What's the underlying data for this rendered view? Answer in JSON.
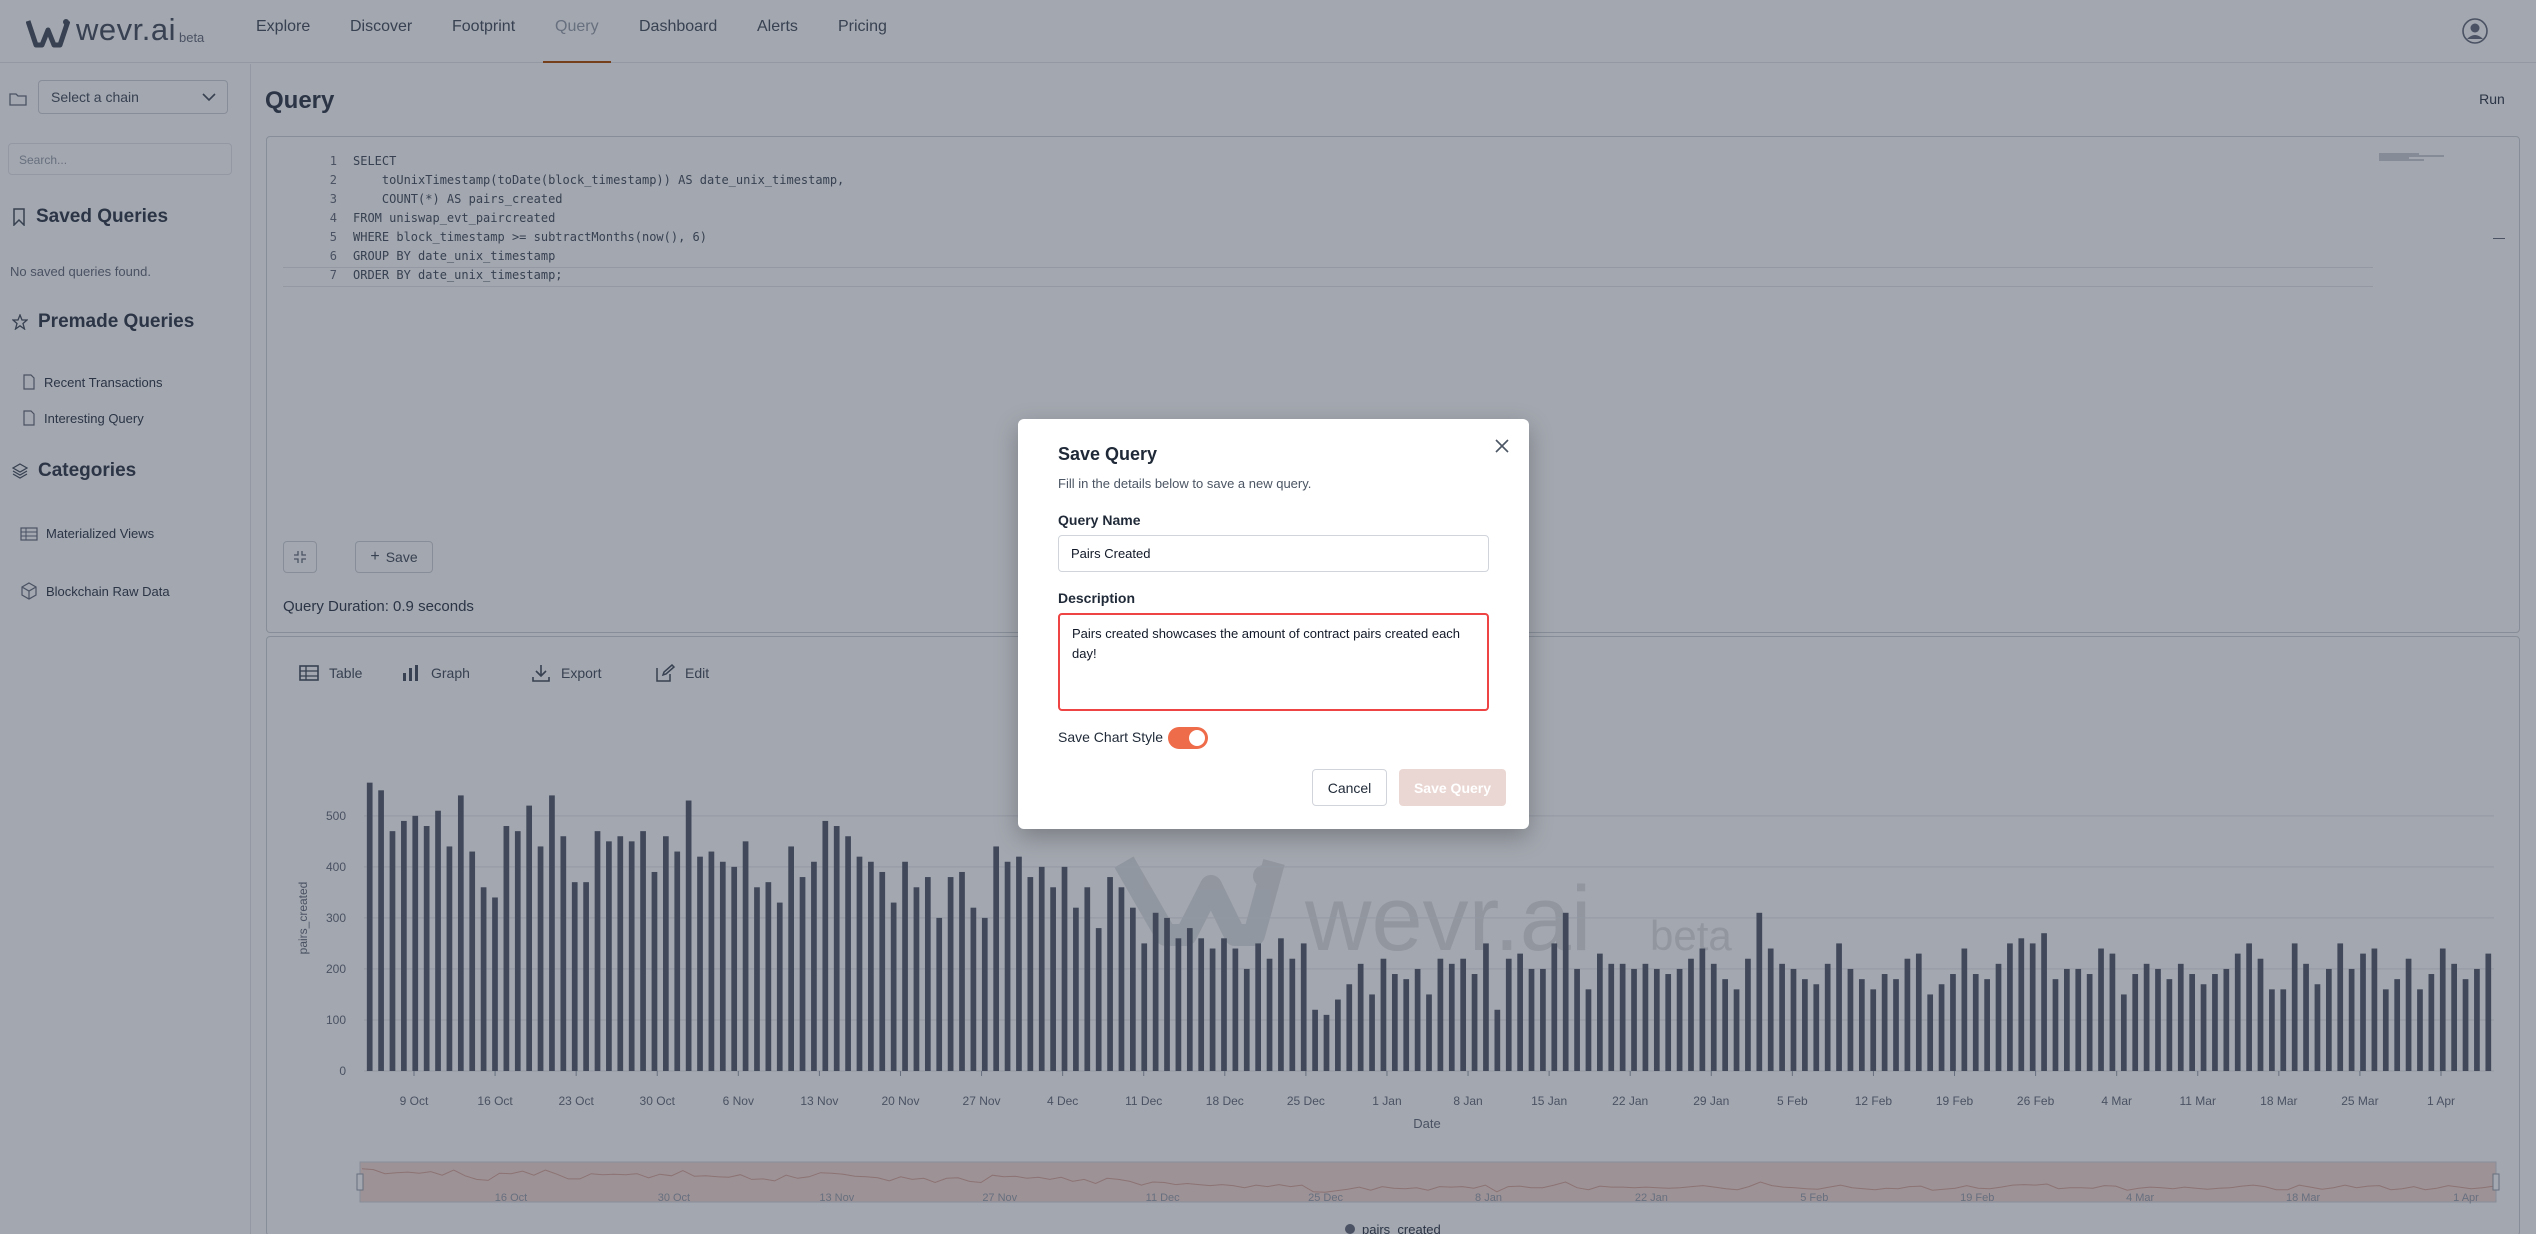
{
  "app": {
    "logo_text": "wevr.ai",
    "logo_beta": "beta"
  },
  "nav": {
    "items": [
      "Explore",
      "Discover",
      "Footprint",
      "Query",
      "Dashboard",
      "Alerts",
      "Pricing"
    ],
    "active": "Query"
  },
  "sidebar": {
    "chain_placeholder": "Select a chain",
    "search_placeholder": "Search...",
    "saved_title": "Saved Queries",
    "saved_empty": "No saved queries found.",
    "premade_title": "Premade Queries",
    "premade_items": [
      "Recent Transactions",
      "Interesting Query"
    ],
    "categories_title": "Categories",
    "category_items": [
      "Materialized Views",
      "Blockchain Raw Data"
    ]
  },
  "page": {
    "title": "Query",
    "run_label": "Run"
  },
  "editor": {
    "lines": [
      {
        "n": "1",
        "text": "SELECT"
      },
      {
        "n": "2",
        "text": "    toUnixTimestamp(toDate(block_timestamp)) AS date_unix_timestamp,"
      },
      {
        "n": "3",
        "text": "    COUNT(*) AS pairs_created"
      },
      {
        "n": "4",
        "text": "FROM uniswap_evt_paircreated"
      },
      {
        "n": "5",
        "text": "WHERE block_timestamp >= subtractMonths(now(), 6)"
      },
      {
        "n": "6",
        "text": "GROUP BY date_unix_timestamp"
      },
      {
        "n": "7",
        "text": "ORDER BY date_unix_timestamp;"
      }
    ],
    "save_label": "Save",
    "duration": "Query Duration: 0.9 seconds"
  },
  "results": {
    "tabs": [
      {
        "label": "Table",
        "icon": "table-icon"
      },
      {
        "label": "Graph",
        "icon": "bar-chart-icon"
      },
      {
        "label": "Export",
        "icon": "download-icon"
      },
      {
        "label": "Edit",
        "icon": "edit-icon"
      }
    ]
  },
  "chart_data": {
    "type": "bar",
    "xlabel": "Date",
    "ylabel": "pairs_created",
    "ylim": [
      0,
      580
    ],
    "yticks": [
      0,
      100,
      200,
      300,
      400,
      500
    ],
    "xticks": [
      "9 Oct",
      "16 Oct",
      "23 Oct",
      "30 Oct",
      "6 Nov",
      "13 Nov",
      "20 Nov",
      "27 Nov",
      "4 Dec",
      "11 Dec",
      "18 Dec",
      "25 Dec",
      "1 Jan",
      "8 Jan",
      "15 Jan",
      "22 Jan",
      "29 Jan",
      "5 Feb",
      "12 Feb",
      "19 Feb",
      "26 Feb",
      "4 Mar",
      "11 Mar",
      "18 Mar",
      "25 Mar",
      "1 Apr"
    ],
    "navigator_ticks": [
      "16 Oct",
      "30 Oct",
      "13 Nov",
      "27 Nov",
      "11 Dec",
      "25 Dec",
      "8 Jan",
      "22 Jan",
      "5 Feb",
      "19 Feb",
      "4 Mar",
      "18 Mar",
      "1 Apr"
    ],
    "legend": "pairs_created",
    "series": [
      {
        "name": "pairs_created",
        "values": [
          565,
          550,
          470,
          490,
          500,
          480,
          510,
          440,
          540,
          430,
          360,
          340,
          480,
          470,
          520,
          440,
          540,
          460,
          370,
          370,
          470,
          450,
          460,
          450,
          470,
          390,
          460,
          430,
          530,
          420,
          430,
          410,
          400,
          450,
          360,
          370,
          330,
          440,
          380,
          410,
          490,
          480,
          460,
          420,
          410,
          390,
          330,
          410,
          360,
          380,
          300,
          380,
          390,
          320,
          300,
          440,
          410,
          420,
          380,
          400,
          360,
          400,
          320,
          360,
          280,
          380,
          360,
          320,
          250,
          310,
          300,
          260,
          280,
          260,
          240,
          260,
          240,
          200,
          250,
          220,
          260,
          220,
          250,
          120,
          110,
          140,
          170,
          210,
          150,
          220,
          190,
          180,
          200,
          150,
          220,
          210,
          220,
          190,
          250,
          120,
          220,
          230,
          200,
          200,
          250,
          310,
          200,
          160,
          230,
          210,
          210,
          200,
          210,
          200,
          190,
          200,
          220,
          240,
          210,
          180,
          160,
          220,
          310,
          240,
          210,
          200,
          180,
          170,
          210,
          250,
          200,
          180,
          160,
          190,
          180,
          220,
          230,
          150,
          170,
          190,
          240,
          190,
          180,
          210,
          250,
          260,
          250,
          270,
          180,
          200,
          200,
          190,
          240,
          230,
          150,
          190,
          210,
          200,
          180,
          210,
          190,
          170,
          190,
          200,
          230,
          250,
          220,
          160,
          160,
          250,
          210,
          170,
          200,
          250,
          200,
          230,
          240,
          160,
          180,
          220,
          160,
          190,
          240,
          210,
          180,
          200,
          230
        ]
      }
    ]
  },
  "modal": {
    "title": "Save Query",
    "subtitle": "Fill in the details below to save a new query.",
    "name_label": "Query Name",
    "name_value": "Pairs Created",
    "desc_label": "Description",
    "desc_value": "Pairs created showcases the amount of contract pairs created each day!",
    "toggle_label": "Save Chart Style",
    "toggle_on": true,
    "cancel_label": "Cancel",
    "save_label": "Save Query",
    "accent": "#ef6c4a"
  }
}
